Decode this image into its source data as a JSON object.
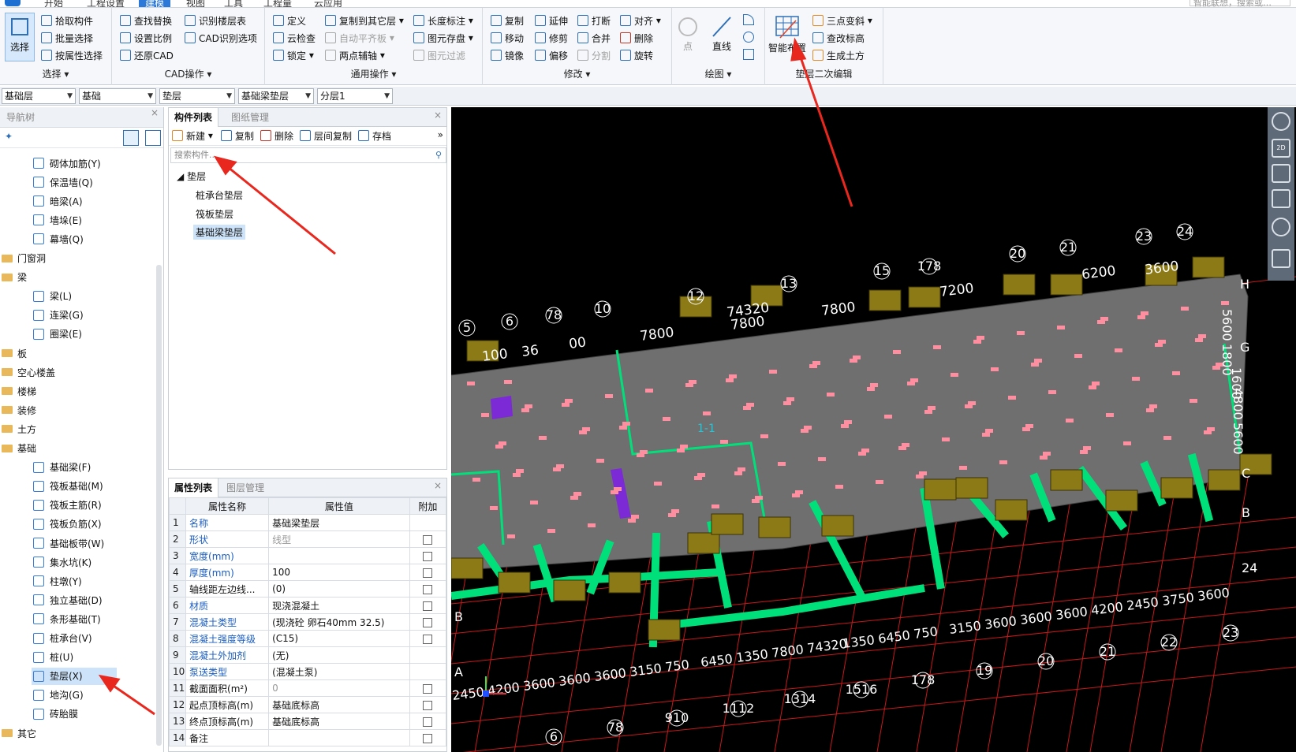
{
  "menu": {
    "tabs": [
      "开始",
      "工程设置",
      "建模",
      "视图",
      "工具",
      "工程量",
      "云应用"
    ],
    "active_tab": "建模",
    "search_placeholder": "智能联想，搜索或…"
  },
  "ribbon": {
    "select": {
      "big_label": "选择",
      "items": [
        "拾取构件",
        "批量选择",
        "按属性选择"
      ],
      "group_label": "选择"
    },
    "cad": {
      "items": [
        "查找替换",
        "识别楼层表",
        "设置比例",
        "CAD识别选项",
        "还原CAD"
      ],
      "group_label": "CAD操作"
    },
    "common": {
      "items": [
        "定义",
        "复制到其它层",
        "长度标注",
        "云检查",
        "自动平齐板",
        "图元存盘",
        "锁定",
        "两点辅轴",
        "图元过滤"
      ],
      "group_label": "通用操作"
    },
    "modify": {
      "items": [
        "复制",
        "延伸",
        "打断",
        "对齐",
        "移动",
        "修剪",
        "合并",
        "删除",
        "镜像",
        "偏移",
        "分割",
        "旋转"
      ],
      "group_label": "修改"
    },
    "draw": {
      "point_label": "点",
      "line_label": "直线",
      "group_label": "绘图"
    },
    "cushion": {
      "big_label": "智能布置",
      "items": [
        "三点变斜",
        "查改标高",
        "生成土方"
      ],
      "group_label": "垫层二次编辑"
    }
  },
  "filters": [
    "基础层",
    "基础",
    "垫层",
    "基础梁垫层",
    "分层1"
  ],
  "nav": {
    "title": "导航树",
    "items": [
      {
        "label": "砌体加筋(Y)",
        "type": "child"
      },
      {
        "label": "保温墙(Q)",
        "type": "child"
      },
      {
        "label": "暗梁(A)",
        "type": "child"
      },
      {
        "label": "墙垛(E)",
        "type": "child"
      },
      {
        "label": "幕墙(Q)",
        "type": "child"
      },
      {
        "label": "门窗洞",
        "type": "folder"
      },
      {
        "label": "梁",
        "type": "folder"
      },
      {
        "label": "梁(L)",
        "type": "child"
      },
      {
        "label": "连梁(G)",
        "type": "child"
      },
      {
        "label": "圈梁(E)",
        "type": "child"
      },
      {
        "label": "板",
        "type": "folder"
      },
      {
        "label": "空心楼盖",
        "type": "folder"
      },
      {
        "label": "楼梯",
        "type": "folder"
      },
      {
        "label": "装修",
        "type": "folder"
      },
      {
        "label": "土方",
        "type": "folder"
      },
      {
        "label": "基础",
        "type": "folder"
      },
      {
        "label": "基础梁(F)",
        "type": "child"
      },
      {
        "label": "筏板基础(M)",
        "type": "child"
      },
      {
        "label": "筏板主筋(R)",
        "type": "child"
      },
      {
        "label": "筏板负筋(X)",
        "type": "child"
      },
      {
        "label": "基础板带(W)",
        "type": "child"
      },
      {
        "label": "集水坑(K)",
        "type": "child"
      },
      {
        "label": "柱墩(Y)",
        "type": "child"
      },
      {
        "label": "独立基础(D)",
        "type": "child"
      },
      {
        "label": "条形基础(T)",
        "type": "child"
      },
      {
        "label": "桩承台(V)",
        "type": "child"
      },
      {
        "label": "桩(U)",
        "type": "child"
      },
      {
        "label": "垫层(X)",
        "type": "child",
        "selected": true
      },
      {
        "label": "地沟(G)",
        "type": "child"
      },
      {
        "label": "砖胎膜",
        "type": "child"
      },
      {
        "label": "其它",
        "type": "folder"
      }
    ]
  },
  "component_panel": {
    "tabs": [
      "构件列表",
      "图纸管理"
    ],
    "toolbar": [
      "新建",
      "复制",
      "删除",
      "层间复制",
      "存档"
    ],
    "search_placeholder": "搜索构件...",
    "root": "垫层",
    "children": [
      "桩承台垫层",
      "筏板垫层",
      "基础梁垫层"
    ],
    "selected": "基础梁垫层"
  },
  "properties": {
    "tabs": [
      "属性列表",
      "图层管理"
    ],
    "headers": [
      "属性名称",
      "属性值",
      "附加"
    ],
    "rows": [
      {
        "n": "1",
        "name": "名称",
        "value": "基础梁垫层",
        "check": false,
        "blue": true,
        "gray": false
      },
      {
        "n": "2",
        "name": "形状",
        "value": "线型",
        "check": true,
        "blue": true,
        "gray": true
      },
      {
        "n": "3",
        "name": "宽度(mm)",
        "value": "",
        "check": true,
        "blue": true,
        "gray": false
      },
      {
        "n": "4",
        "name": "厚度(mm)",
        "value": "100",
        "check": true,
        "blue": true,
        "gray": false
      },
      {
        "n": "5",
        "name": "轴线距左边线...",
        "value": "(0)",
        "check": true,
        "blue": false,
        "gray": false
      },
      {
        "n": "6",
        "name": "材质",
        "value": "现浇混凝土",
        "check": true,
        "blue": true,
        "gray": false
      },
      {
        "n": "7",
        "name": "混凝土类型",
        "value": "(现浇砼 卵石40mm 32.5)",
        "check": true,
        "blue": true,
        "gray": false
      },
      {
        "n": "8",
        "name": "混凝土强度等级",
        "value": "(C15)",
        "check": true,
        "blue": true,
        "gray": false
      },
      {
        "n": "9",
        "name": "混凝土外加剂",
        "value": "(无)",
        "check": false,
        "blue": true,
        "gray": false
      },
      {
        "n": "10",
        "name": "泵送类型",
        "value": "(混凝土泵)",
        "check": false,
        "blue": true,
        "gray": false
      },
      {
        "n": "11",
        "name": "截面面积(m²)",
        "value": "0",
        "check": true,
        "blue": false,
        "gray": true
      },
      {
        "n": "12",
        "name": "起点顶标高(m)",
        "value": "基础底标高",
        "check": true,
        "blue": false,
        "gray": false
      },
      {
        "n": "13",
        "name": "终点顶标高(m)",
        "value": "基础底标高",
        "check": true,
        "blue": false,
        "gray": false
      },
      {
        "n": "14",
        "name": "备注",
        "value": "",
        "check": true,
        "blue": false,
        "gray": false
      }
    ]
  },
  "canvas": {
    "colors": {
      "background": "#000000",
      "slab": "#6f6f6f",
      "cushion": "#00e07a",
      "cap": "#8c7a16",
      "axis": "#c81818",
      "label": "#ffffff",
      "annotation": "#ff8fa0"
    },
    "axis_labels_top": [
      "5",
      "6",
      "78",
      "10",
      "12",
      "13",
      "15",
      "178",
      "20",
      "21",
      "23",
      "24"
    ],
    "dims_top": [
      "100",
      "36",
      "00",
      "7800",
      "74320",
      "7800",
      "7800",
      "7200",
      "6200",
      "3600"
    ],
    "right_letters": [
      "H",
      "G",
      "C",
      "B",
      "24"
    ],
    "right_dims": [
      "5600",
      "1800",
      "1600",
      "4800",
      "5600"
    ],
    "bottom_letters": [
      "B",
      "A"
    ],
    "dims_bottom": [
      "2450",
      "4200",
      "3600",
      "3600",
      "3600",
      "3150",
      "750",
      "6450",
      "1350",
      "7800",
      "74320",
      "1350",
      "6450",
      "750",
      "3150",
      "3600",
      "3600",
      "3600",
      "4200",
      "2450",
      "3750",
      "3600"
    ],
    "axis_labels_bottom": [
      "6",
      "78",
      "910",
      "1112",
      "1314",
      "1516",
      "178",
      "19",
      "20",
      "21",
      "22",
      "23"
    ],
    "center_tag": "1-1"
  }
}
